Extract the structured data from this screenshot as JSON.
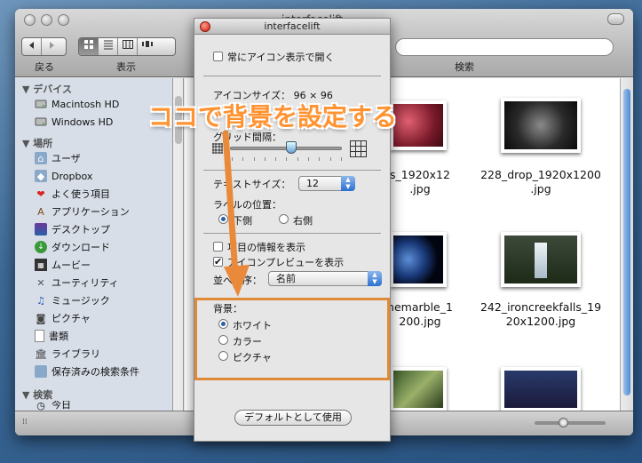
{
  "window": {
    "title": "interfacelift"
  },
  "toolbar": {
    "back_label": "戻る",
    "view_label": "表示",
    "search_label": "検索"
  },
  "sidebar": {
    "devices_header": "デバイス",
    "devices": [
      {
        "label": "Macintosh HD",
        "icon": "hard-disk-icon"
      },
      {
        "label": "Windows HD",
        "icon": "hard-disk-icon"
      }
    ],
    "places_header": "場所",
    "places": [
      {
        "label": "ユーザ",
        "icon": "home-folder-icon"
      },
      {
        "label": "Dropbox",
        "icon": "dropbox-folder-icon"
      },
      {
        "label": "よく使う項目",
        "icon": "heart-icon"
      },
      {
        "label": "アプリケーション",
        "icon": "applications-icon"
      },
      {
        "label": "デスクトップ",
        "icon": "desktop-icon"
      },
      {
        "label": "ダウンロード",
        "icon": "download-icon"
      },
      {
        "label": "ムービー",
        "icon": "film-icon"
      },
      {
        "label": "ユーティリティ",
        "icon": "tools-icon"
      },
      {
        "label": "ミュージック",
        "icon": "music-icon"
      },
      {
        "label": "ピクチャ",
        "icon": "camera-icon"
      },
      {
        "label": "書類",
        "icon": "document-icon"
      },
      {
        "label": "ライブラリ",
        "icon": "library-icon"
      },
      {
        "label": "保存済みの検索条件",
        "icon": "folder-icon"
      }
    ],
    "search_header": "検索",
    "search_partial": "今日"
  },
  "files": [
    {
      "caption": "s_1920x12\n.jpg"
    },
    {
      "caption": "228_drop_1920x1200\n.jpg"
    },
    {
      "caption": "nemarble_1\n200.jpg"
    },
    {
      "caption": "242_ironcreekfalls_19\n20x1200.jpg"
    }
  ],
  "panel": {
    "title": "interfacelift",
    "always_open_icon": "常にアイコン表示で開く",
    "icon_size_label": "アイコンサイズ：",
    "icon_size_value": "96 × 96",
    "grid_spacing_label": "グリッド間隔：",
    "icon_size_fraction": 0.55,
    "text_size_label": "テキストサイズ：",
    "text_size_value": "12",
    "label_position_label": "ラベルの位置：",
    "label_bottom": "下側",
    "label_right": "右側",
    "show_item_info": "項目の情報を表示",
    "show_icon_preview": "アイコンプレビューを表示",
    "arrange_label": "並べ順序：",
    "arrange_value": "名前",
    "background_label": "背景：",
    "bg_white": "ホワイト",
    "bg_color": "カラー",
    "bg_picture": "ピクチャ",
    "default_button": "デフォルトとして使用"
  },
  "annotation": {
    "callout": "ココで背景を設定する",
    "color": "#ff9331"
  }
}
